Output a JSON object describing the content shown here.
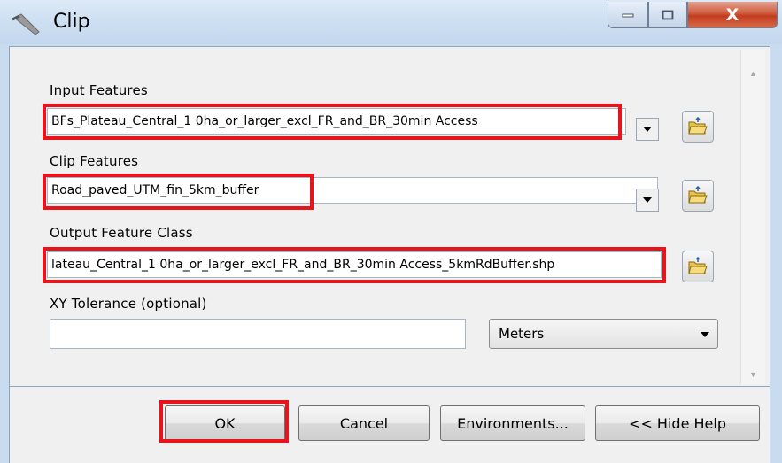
{
  "window": {
    "title": "Clip",
    "close_glyph": "X"
  },
  "form": {
    "input_features": {
      "label": "Input Features",
      "value": "BFs_Plateau_Central_1 0ha_or_larger_excl_FR_and_BR_30min Access"
    },
    "clip_features": {
      "label": "Clip Features",
      "value": "Road_paved_UTM_fin_5km_buffer"
    },
    "output_feature_class": {
      "label": "Output Feature Class",
      "value": "lateau_Central_1 0ha_or_larger_excl_FR_and_BR_30min Access_5kmRdBuffer.shp"
    },
    "xy_tolerance": {
      "label": "XY Tolerance (optional)",
      "value": "",
      "unit": "Meters"
    }
  },
  "buttons": {
    "ok": "OK",
    "cancel": "Cancel",
    "environments": "Environments...",
    "hide_help": "<< Hide Help"
  },
  "colors": {
    "highlight": "#e8141c",
    "title_bar": "#cddff2",
    "close_button": "#c23c1e"
  },
  "icons": [
    "clip-tool-icon",
    "minimize-icon",
    "maximize-icon",
    "close-icon",
    "chevron-down-icon",
    "open-folder-icon",
    "scroll-up-icon",
    "scroll-down-icon"
  ]
}
